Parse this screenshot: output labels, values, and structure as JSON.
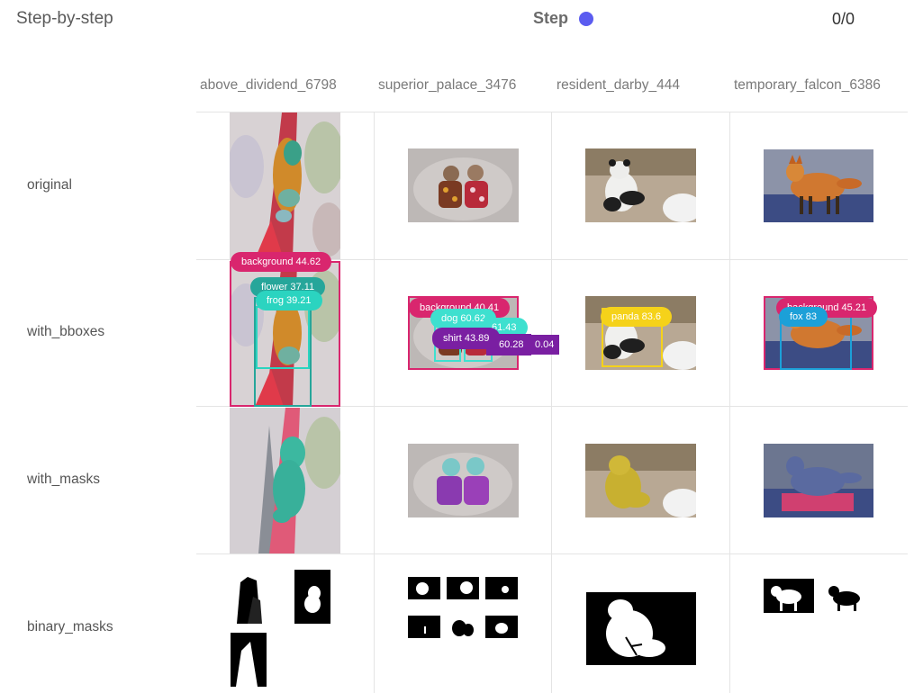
{
  "header": {
    "title": "Step-by-step",
    "step_label": "Step",
    "step_color": "#5b5cf0",
    "counter": "0/0"
  },
  "columns": [
    {
      "label": "above_dividend_6798"
    },
    {
      "label": "superior_palace_3476"
    },
    {
      "label": "resident_darby_444"
    },
    {
      "label": "temporary_falcon_6386"
    }
  ],
  "rows": [
    {
      "label": "original"
    },
    {
      "label": "with_bboxes"
    },
    {
      "label": "with_masks"
    },
    {
      "label": "binary_masks"
    }
  ],
  "bbox_labels": {
    "frog": {
      "background": "background 44.62",
      "flower": "flower 37.11",
      "frog": "frog 39.21"
    },
    "dogs": {
      "background": "background 40.41",
      "dog1": "dog 60.62",
      "dog2": "61.43",
      "shirt": "shirt 43.89",
      "shirt2": "60.28",
      "shirt3": "0.04"
    },
    "panda": {
      "panda": "panda 83.6"
    },
    "fox": {
      "background": "background 45.21",
      "fox": "fox 83"
    }
  },
  "colors": {
    "background_tag": "#d9266e",
    "flower_tag": "#26a69a",
    "frog_tag": "#2bd4c0",
    "dog_tag": "#3ee0cf",
    "shirt_tag": "#7a1fa2",
    "panda_tag": "#f5d21a",
    "fox_tag": "#1ca0d8"
  }
}
